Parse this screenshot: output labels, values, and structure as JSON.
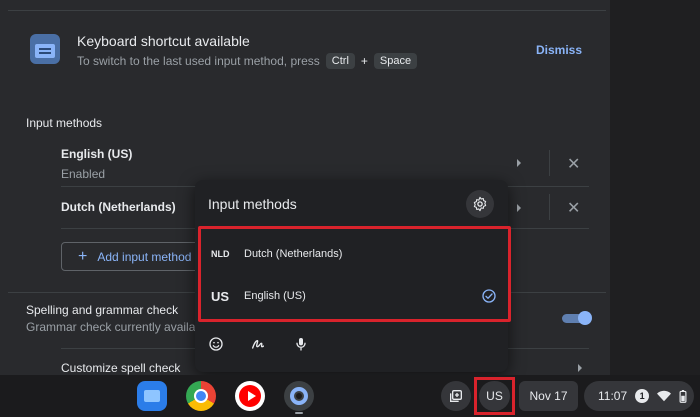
{
  "banner": {
    "title": "Keyboard shortcut available",
    "description": "To switch to the last used input method, press",
    "key_ctrl": "Ctrl",
    "plus": "+",
    "key_space": "Space",
    "dismiss_label": "Dismiss"
  },
  "input_methods_section": {
    "title": "Input methods",
    "items": [
      {
        "name": "English (US)",
        "status": "Enabled"
      },
      {
        "name": "Dutch (Netherlands)",
        "status": ""
      }
    ],
    "add_label": "Add input method"
  },
  "spelling": {
    "title": "Spelling and grammar check",
    "subtitle": "Grammar check currently availab",
    "enabled": true,
    "customize_label": "Customize spell check"
  },
  "popup": {
    "title": "Input methods",
    "items": [
      {
        "code": "NLD",
        "name": "Dutch (Netherlands)",
        "selected": false
      },
      {
        "code": "US",
        "name": "English (US)",
        "selected": true
      }
    ],
    "icons": [
      "emoji-icon",
      "handwriting-icon",
      "microphone-icon"
    ]
  },
  "shelf": {
    "apps": [
      "files-icon",
      "chrome-icon",
      "youtube-music-icon",
      "settings-app-icon"
    ],
    "ime_label": "US",
    "date": "Nov 17",
    "time": "11:07",
    "notification_count": "1"
  },
  "colors": {
    "accent": "#8ab4f8",
    "highlight": "#d9232c",
    "background": "#292a2d"
  }
}
